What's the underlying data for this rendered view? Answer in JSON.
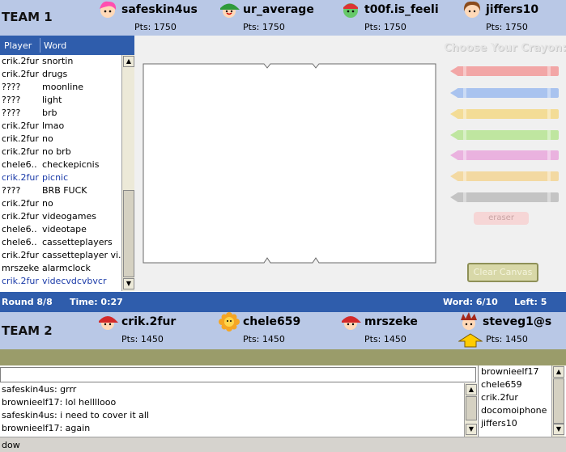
{
  "team1": {
    "label": "TEAM 1",
    "players": [
      {
        "name": "safeskin4us",
        "points": "Pts: 1750",
        "avatar": "pink-hair-avatar-icon"
      },
      {
        "name": "ur_average",
        "points": "Pts: 1750",
        "avatar": "green-cap-avatar-icon"
      },
      {
        "name": "t00f.is_feeli",
        "points": "Pts: 1750",
        "avatar": "green-face-avatar-icon"
      },
      {
        "name": "jiffers10",
        "points": "Pts: 1750",
        "avatar": "brown-hair-avatar-icon"
      }
    ]
  },
  "team2": {
    "label": "TEAM 2",
    "players": [
      {
        "name": "crik.2fur",
        "points": "Pts: 1450",
        "avatar": "red-cap-avatar-icon"
      },
      {
        "name": "chele659",
        "points": "Pts: 1450",
        "avatar": "sunflower-avatar-icon"
      },
      {
        "name": "mrszeke",
        "points": "Pts: 1450",
        "avatar": "red-cap-avatar-icon"
      },
      {
        "name": "steveg1@s",
        "points": "Pts: 1450",
        "avatar": "spiky-hair-avatar-icon"
      }
    ]
  },
  "wordlist": {
    "col_player": "Player",
    "col_word": "Word",
    "rows": [
      {
        "player": "crik.2fur",
        "word": "snortin",
        "highlight": false
      },
      {
        "player": "crik.2fur",
        "word": "drugs",
        "highlight": false
      },
      {
        "player": "????",
        "word": "moonline",
        "highlight": false
      },
      {
        "player": "????",
        "word": "light",
        "highlight": false
      },
      {
        "player": "????",
        "word": "brb",
        "highlight": false
      },
      {
        "player": "crik.2fur",
        "word": "lmao",
        "highlight": false
      },
      {
        "player": "crik.2fur",
        "word": "no",
        "highlight": false
      },
      {
        "player": "crik.2fur",
        "word": "no brb",
        "highlight": false
      },
      {
        "player": "chele6..",
        "word": "checkepicnis",
        "highlight": false
      },
      {
        "player": "crik.2fur",
        "word": "picnic",
        "highlight": true
      },
      {
        "player": "????",
        "word": "BRB FUCK",
        "highlight": false
      },
      {
        "player": "crik.2fur",
        "word": "no",
        "highlight": false
      },
      {
        "player": "crik.2fur",
        "word": "videogames",
        "highlight": false
      },
      {
        "player": "chele6..",
        "word": "videotape",
        "highlight": false
      },
      {
        "player": "chele6..",
        "word": "cassetteplayers",
        "highlight": false
      },
      {
        "player": "crik.2fur",
        "word": "cassetteplayer vi..",
        "highlight": false
      },
      {
        "player": "mrszeke",
        "word": "alarmclock",
        "highlight": false
      },
      {
        "player": "crik.2fur",
        "word": "videcvdcvbvcr",
        "highlight": true
      }
    ]
  },
  "crayons": {
    "title": "Choose Your Crayon:",
    "colors": [
      "#f2a6a6",
      "#a9c3ef",
      "#f3dc96",
      "#bfe6a0",
      "#eab2df",
      "#f3d9a2",
      "#c4c4c4"
    ],
    "eraser_label": "eraser",
    "clear_label": "Clear Canvas"
  },
  "status": {
    "round": "Round 8/8",
    "time": "Time: 0:27",
    "word": "Word: 6/10",
    "left": "Left: 5"
  },
  "chat": {
    "input_value": "",
    "lines": [
      "safeskin4us: grrr",
      "brownieelf17: lol hellllooo",
      "safeskin4us: i need to cover it all",
      "brownieelf17: again"
    ]
  },
  "users": [
    "brownieelf17",
    "chele659",
    "crik.2fur",
    "docomoiphone",
    "jiffers10"
  ],
  "bottom_status": "dow"
}
